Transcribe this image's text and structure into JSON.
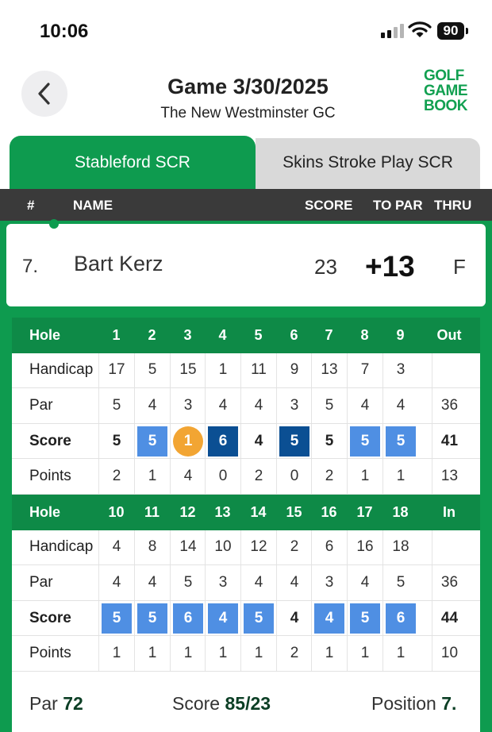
{
  "status_bar": {
    "time": "10:06",
    "battery": "90"
  },
  "header": {
    "title": "Game 3/30/2025",
    "subtitle": "The New Westminster GC",
    "logo": [
      "GOLF",
      "GAME",
      "BOOK"
    ]
  },
  "tabs": [
    {
      "label": "Stableford SCR",
      "active": true
    },
    {
      "label": "Skins Stroke Play SCR",
      "active": false
    }
  ],
  "leaderboard_header": {
    "rank": "#",
    "name": "NAME",
    "score": "SCORE",
    "to_par": "TO PAR",
    "thru": "THRU"
  },
  "player": {
    "rank": "7.",
    "name": "Bart Kerz",
    "score": "23",
    "to_par": "+13",
    "thru": "F"
  },
  "scorecard": {
    "front": {
      "holes_label": "Hole",
      "holes": [
        "1",
        "2",
        "3",
        "4",
        "5",
        "6",
        "7",
        "8",
        "9"
      ],
      "total_label": "Out",
      "handicap": {
        "label": "Handicap",
        "values": [
          "17",
          "5",
          "15",
          "1",
          "11",
          "9",
          "13",
          "7",
          "3"
        ],
        "total": ""
      },
      "par": {
        "label": "Par",
        "values": [
          "5",
          "4",
          "3",
          "4",
          "4",
          "3",
          "5",
          "4",
          "4"
        ],
        "total": "36"
      },
      "score": {
        "label": "Score",
        "values": [
          "5",
          "5",
          "1",
          "6",
          "4",
          "5",
          "5",
          "5",
          "5"
        ],
        "marks": [
          "",
          "bogey",
          "birdie",
          "double",
          "",
          "double",
          "",
          "bogey",
          "bogey"
        ],
        "total": "41"
      },
      "points": {
        "label": "Points",
        "values": [
          "2",
          "1",
          "4",
          "0",
          "2",
          "0",
          "2",
          "1",
          "1"
        ],
        "total": "13"
      }
    },
    "back": {
      "holes_label": "Hole",
      "holes": [
        "10",
        "11",
        "12",
        "13",
        "14",
        "15",
        "16",
        "17",
        "18"
      ],
      "total_label": "In",
      "handicap": {
        "label": "Handicap",
        "values": [
          "4",
          "8",
          "14",
          "10",
          "12",
          "2",
          "6",
          "16",
          "18"
        ],
        "total": ""
      },
      "par": {
        "label": "Par",
        "values": [
          "4",
          "4",
          "5",
          "3",
          "4",
          "4",
          "3",
          "4",
          "5"
        ],
        "total": "36"
      },
      "score": {
        "label": "Score",
        "values": [
          "5",
          "5",
          "6",
          "4",
          "5",
          "4",
          "4",
          "5",
          "6"
        ],
        "marks": [
          "bogey",
          "bogey",
          "bogey",
          "bogey",
          "bogey",
          "",
          "bogey",
          "bogey",
          "bogey"
        ],
        "total": "44"
      },
      "points": {
        "label": "Points",
        "values": [
          "1",
          "1",
          "1",
          "1",
          "1",
          "2",
          "1",
          "1",
          "1"
        ],
        "total": "10"
      }
    }
  },
  "summary": {
    "par_label": "Par",
    "par_value": "72",
    "score_label": "Score",
    "score_value": "85/23",
    "position_label": "Position",
    "position_value": "7."
  },
  "colors": {
    "brand_green": "#0e9b4f",
    "bogey": "#4f8fe3",
    "double_bogey": "#0b4f93",
    "birdie": "#f2a533"
  }
}
